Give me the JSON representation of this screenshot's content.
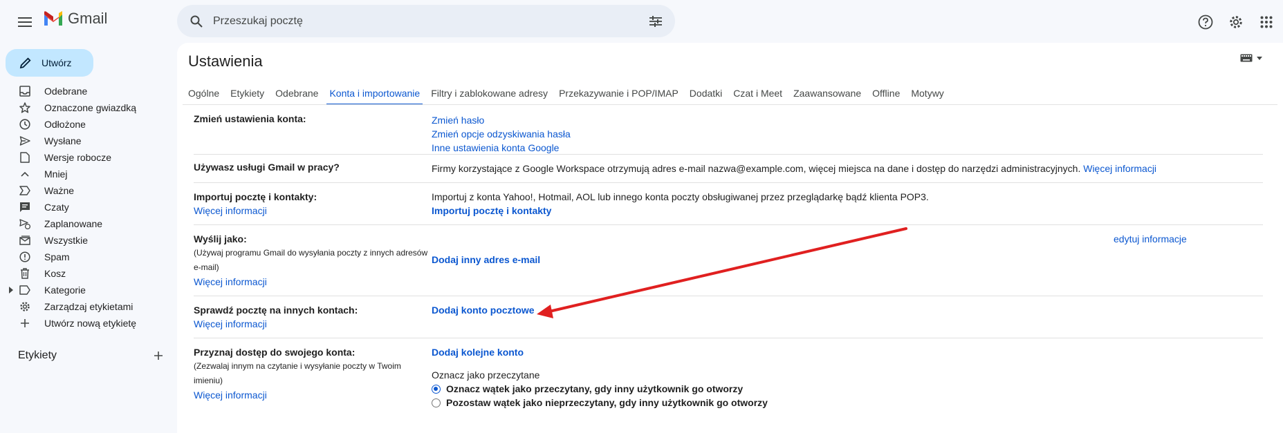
{
  "app": {
    "name": "Gmail"
  },
  "search": {
    "placeholder": "Przeszukaj pocztę"
  },
  "compose": {
    "label": "Utwórz"
  },
  "nav": {
    "items": [
      {
        "label": "Odebrane",
        "icon": "inbox-icon"
      },
      {
        "label": "Oznaczone gwiazdką",
        "icon": "star-icon"
      },
      {
        "label": "Odłożone",
        "icon": "clock-icon"
      },
      {
        "label": "Wysłane",
        "icon": "send-icon"
      },
      {
        "label": "Wersje robocze",
        "icon": "file-icon"
      },
      {
        "label": "Mniej",
        "icon": "chevron-up-icon"
      },
      {
        "label": "Ważne",
        "icon": "label-important-icon"
      },
      {
        "label": "Czaty",
        "icon": "chat-icon"
      },
      {
        "label": "Zaplanowane",
        "icon": "schedule-send-icon"
      },
      {
        "label": "Wszystkie",
        "icon": "all-mail-icon"
      },
      {
        "label": "Spam",
        "icon": "report-icon"
      },
      {
        "label": "Kosz",
        "icon": "trash-icon"
      },
      {
        "label": "Kategorie",
        "icon": "label-icon"
      },
      {
        "label": "Zarządzaj etykietami",
        "icon": "gear-icon"
      },
      {
        "label": "Utwórz nową etykietę",
        "icon": "plus-icon"
      }
    ]
  },
  "labels_section": {
    "title": "Etykiety"
  },
  "settings": {
    "title": "Ustawienia",
    "tabs": [
      "Ogólne",
      "Etykiety",
      "Odebrane",
      "Konta i importowanie",
      "Filtry i zablokowane adresy",
      "Przekazywanie i POP/IMAP",
      "Dodatki",
      "Czat i Meet",
      "Zaawansowane",
      "Offline",
      "Motywy"
    ],
    "active_tab": "Konta i importowanie",
    "rows": {
      "change_account": {
        "label": "Zmień ustawienia konta:",
        "links": [
          "Zmień hasło",
          "Zmień opcje odzyskiwania hasła",
          "Inne ustawienia konta Google"
        ]
      },
      "work": {
        "label": "Używasz usługi Gmail w pracy?",
        "text": "Firmy korzystające z Google Workspace otrzymują adres e-mail nazwa@example.com, więcej miejsca na dane i dostęp do narzędzi administracyjnych.",
        "link": "Więcej informacji"
      },
      "import": {
        "label": "Importuj pocztę i kontakty:",
        "more": "Więcej informacji",
        "text": "Importuj z konta Yahoo!, Hotmail, AOL lub innego konta poczty obsługiwanej przez przeglądarkę bądź klienta POP3.",
        "action": "Importuj pocztę i kontakty"
      },
      "send_as": {
        "label": "Wyślij jako:",
        "desc": "(Używaj programu Gmail do wysyłania poczty z innych adresów e-mail)",
        "more": "Więcej informacji",
        "action": "Dodaj inny adres e-mail",
        "edit": "edytuj informacje"
      },
      "check_mail": {
        "label": "Sprawdź pocztę na innych kontach:",
        "more": "Więcej informacji",
        "action": "Dodaj konto pocztowe"
      },
      "grant": {
        "label": "Przyznaj dostęp do swojego konta:",
        "desc": "(Zezwalaj innym na czytanie i wysyłanie poczty w Twoim imieniu)",
        "more": "Więcej informacji",
        "action": "Dodaj kolejne konto",
        "mark_read_title": "Oznacz jako przeczytane",
        "option1": "Oznacz wątek jako przeczytany, gdy inny użytkownik go otworzy",
        "option2": "Pozostaw wątek jako nieprzeczytany, gdy inny użytkownik go otworzy"
      }
    }
  },
  "colors": {
    "accent": "#0b57d0",
    "compose_bg": "#c2e7ff",
    "annotation_arrow": "#e02020"
  }
}
